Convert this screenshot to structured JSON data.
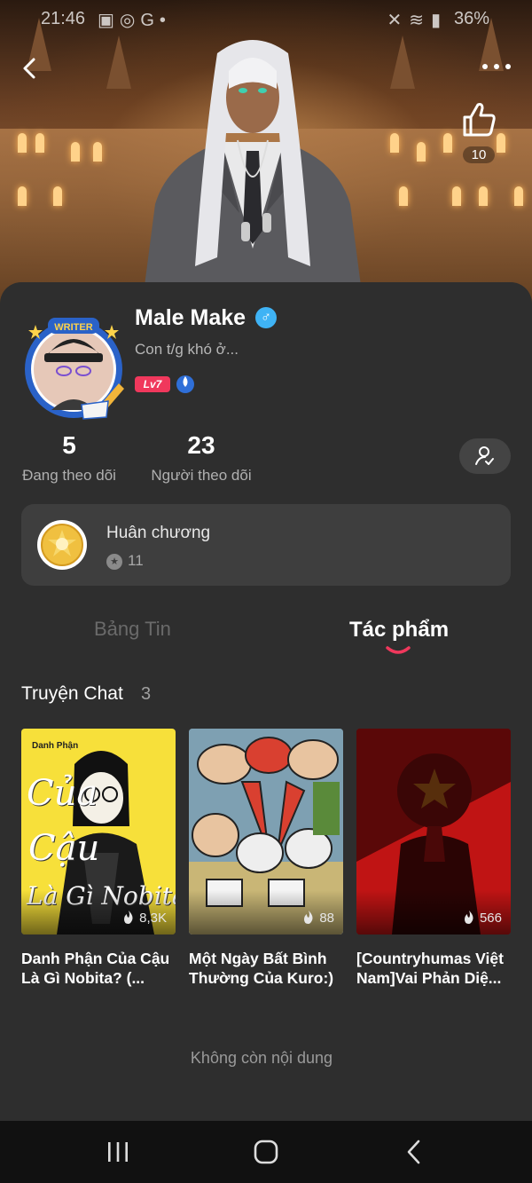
{
  "status_bar": {
    "time": "21:46",
    "left_icons": [
      "gallery-icon",
      "instagram-icon",
      "google-icon",
      "dot-icon"
    ],
    "battery": "36%",
    "right_icons": [
      "mute-icon",
      "wifi-icon",
      "signal-icon"
    ]
  },
  "header": {
    "like_count": "10"
  },
  "profile": {
    "name": "Male Make",
    "gender_symbol": "♂",
    "bio": "Con t/g khó ở...",
    "level": "Lv7",
    "avatar_badge": "WRITER",
    "following_count": "5",
    "following_label": "Đang theo dõi",
    "followers_count": "23",
    "followers_label": "Người theo dõi"
  },
  "medals": {
    "title": "Huân chương",
    "count": "11"
  },
  "tabs": [
    {
      "label": "Bảng Tin",
      "active": false
    },
    {
      "label": "Tác phẩm",
      "active": true
    }
  ],
  "section": {
    "title": "Truyện Chat",
    "count": "3"
  },
  "stories": [
    {
      "title": "Danh Phận Của Cậu Là Gì Nobita? (...",
      "views": "8,3K",
      "cover_lines": [
        "Danh Phận",
        "Của",
        "Cậu",
        "Là Gì Nobita?"
      ]
    },
    {
      "title": "Một Ngày Bất Bình Thường Của Kuro:)",
      "views": "88"
    },
    {
      "title": "[Countryhumas Việt Nam]Vai Phản Diệ...",
      "views": "566"
    }
  ],
  "end_text": "Không còn nội dung",
  "colors": {
    "accent_pink": "#f0385c",
    "gender_blue": "#3fb3f5",
    "card_bg": "#2e2e2e"
  }
}
